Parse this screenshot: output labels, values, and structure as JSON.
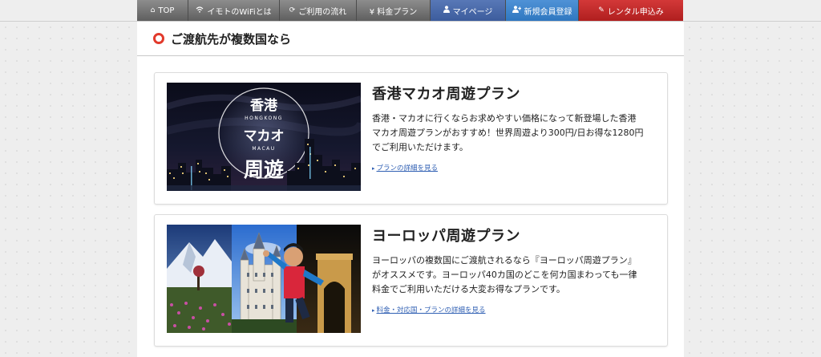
{
  "nav": {
    "items": [
      {
        "label": "TOP",
        "icon": "home-icon"
      },
      {
        "label": "イモトのWiFiとは",
        "icon": "wifi-icon"
      },
      {
        "label": "ご利用の流れ",
        "icon": "refresh-icon"
      },
      {
        "label": "¥ 料金プラン",
        "icon": ""
      },
      {
        "label": "マイページ",
        "icon": "user-icon"
      },
      {
        "label": "新規会員登録",
        "icon": "user-plus-icon"
      },
      {
        "label": "レンタル申込み",
        "icon": "pencil-icon"
      }
    ]
  },
  "section": {
    "title": "ご渡航先が複数国なら"
  },
  "cards": [
    {
      "title": "香港マカオ周遊プラン",
      "desc": "香港・マカオに行くならお求めやすい価格になって新登場した香港マカオ周遊プランがおすすめ！世界周遊より300円/日お得な1280円でご利用いただけます。",
      "link": "プランの詳細を見る",
      "image": {
        "line1": "香港",
        "line2": "HONGKONG",
        "line3": "マカオ",
        "line4": "MACAU",
        "line5": "周遊"
      }
    },
    {
      "title": "ヨーロッパ周遊プラン",
      "desc": "ヨーロッパの複数国にご渡航されるなら『ヨーロッパ周遊プラン』がオススメです。ヨーロッパ40カ国のどこを何カ国まわっても一律料金でご利用いただける大変お得なプランです。",
      "link": "料金・対応国・プランの詳細を見る"
    }
  ],
  "colors": {
    "accent_red": "#e23a2c",
    "mypage_blue": "#3c5c9d",
    "register_blue": "#2f77c0",
    "rental_red": "#b01f1f",
    "link_blue": "#2f5fb3"
  }
}
